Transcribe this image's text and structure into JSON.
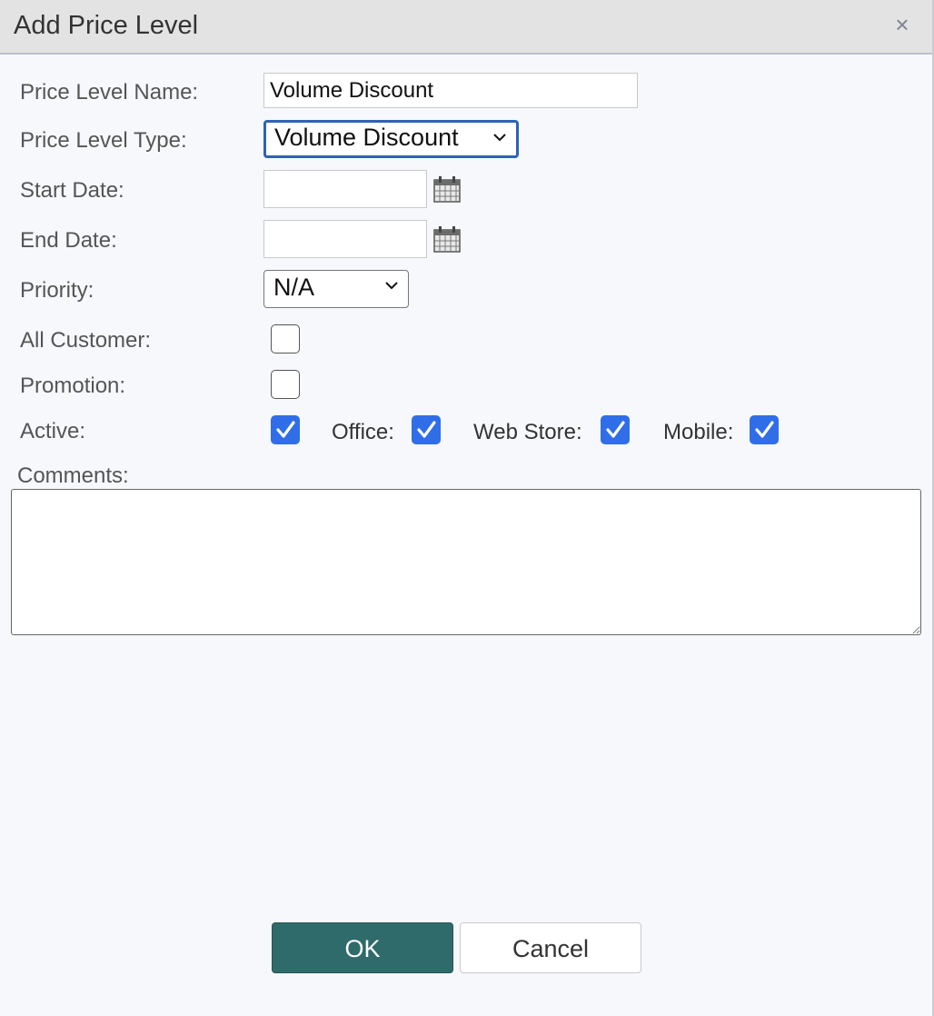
{
  "dialog": {
    "title": "Add Price Level",
    "close_icon": "close-icon"
  },
  "form": {
    "name_label": "Price Level Name:",
    "name_value": "Volume Discount",
    "type_label": "Price Level Type:",
    "type_value": "Volume Discount",
    "start_label": "Start Date:",
    "start_value": "",
    "end_label": "End Date:",
    "end_value": "",
    "priority_label": "Priority:",
    "priority_value": "N/A",
    "all_customer_label": "All Customer:",
    "all_customer_checked": false,
    "promotion_label": "Promotion:",
    "promotion_checked": false,
    "active_label": "Active:",
    "active_checked": true,
    "office_label": "Office:",
    "office_checked": true,
    "webstore_label": "Web Store:",
    "webstore_checked": true,
    "mobile_label": "Mobile:",
    "mobile_checked": true,
    "comments_label": "Comments:",
    "comments_value": ""
  },
  "buttons": {
    "ok": "OK",
    "cancel": "Cancel"
  },
  "colors": {
    "accent": "#2f6ee8",
    "ok_button": "#2f6b6b",
    "focus_border": "#2e62b8"
  }
}
